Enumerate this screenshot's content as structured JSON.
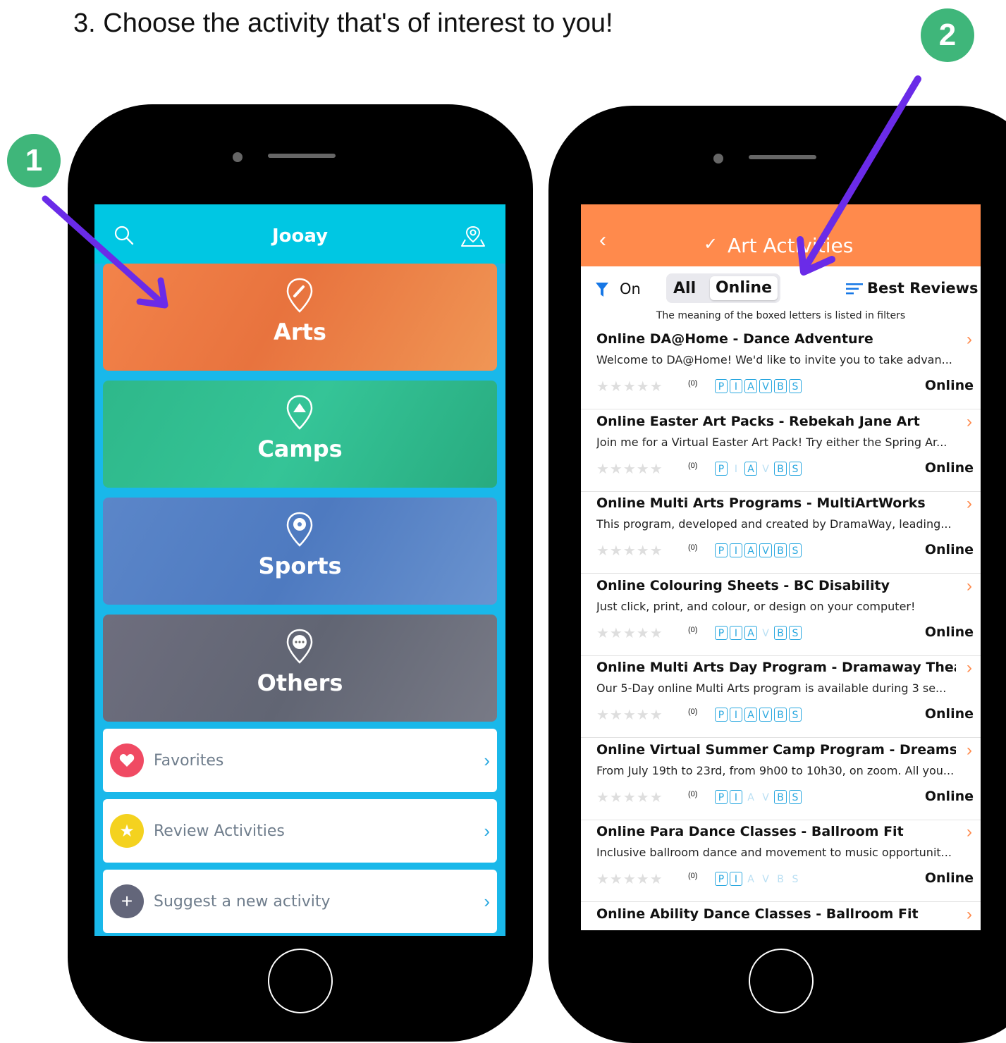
{
  "instruction": "3. Choose the activity that's of interest to you!",
  "badges": {
    "one": "1",
    "two": "2"
  },
  "colors": {
    "badge": "#3fb67a",
    "arrow": "#6a2be8",
    "jooay_header": "#00c7e3",
    "art_header": "#ff8a4c"
  },
  "left_app": {
    "title": "Jooay",
    "icons": {
      "left": "search-icon",
      "right": "map-pin-icon"
    },
    "categories": [
      {
        "label": "Arts",
        "icon": "paintbrush-icon"
      },
      {
        "label": "Camps",
        "icon": "tent-icon"
      },
      {
        "label": "Sports",
        "icon": "soccer-ball-icon"
      },
      {
        "label": "Others",
        "icon": "more-icon"
      }
    ],
    "menu": [
      {
        "label": "Favorites",
        "icon": "heart-icon"
      },
      {
        "label": "Review Activities",
        "icon": "star-icon"
      },
      {
        "label": "Suggest a new activity",
        "icon": "plus-icon"
      }
    ]
  },
  "right_app": {
    "title": "Art Activities",
    "filter_state": "On",
    "segments": {
      "all": "All",
      "online": "Online",
      "selected": "Online"
    },
    "sort": "Best Reviews",
    "note": "The meaning of the boxed letters is listed in filters",
    "activities": [
      {
        "title": "Online DA@Home - Dance Adventure",
        "desc": "Welcome to DA@Home! We'd like to invite you to take advan...",
        "rating": "(0)",
        "mode": "Online",
        "letters": "P,I,A,V,B,S",
        "boxed": "1,1,1,1,1,1"
      },
      {
        "title": "Online Easter Art Packs - Rebekah Jane Art",
        "desc": "Join me for a Virtual Easter Art Pack! Try either the Spring Ar...",
        "rating": "(0)",
        "mode": "Online",
        "letters": "P,I,A,V,B,S",
        "boxed": "1,0,1,0,1,1"
      },
      {
        "title": "Online Multi Arts Programs - MultiArtWorks",
        "desc": "This program, developed and created by DramaWay, leading...",
        "rating": "(0)",
        "mode": "Online",
        "letters": "P,I,A,V,B,S",
        "boxed": "1,1,1,1,1,1"
      },
      {
        "title": "Online Colouring Sheets - BC Disability",
        "desc": "Just click, print, and colour, or design on your computer!",
        "rating": "(0)",
        "mode": "Online",
        "letters": "P,I,A,V,B,S",
        "boxed": "1,1,1,0,1,1"
      },
      {
        "title": "Online Multi Arts Day Program - Dramaway Theatre",
        "desc": "Our 5-Day online Multi Arts program is available during 3 se...",
        "rating": "(0)",
        "mode": "Online",
        "letters": "P,I,A,V,B,S",
        "boxed": "1,1,1,1,1,1"
      },
      {
        "title": "Online Virtual Summer Camp Program - Dreams C...",
        "desc": "From July 19th to 23rd, from 9h00 to 10h30, on zoom. All you...",
        "rating": "(0)",
        "mode": "Online",
        "letters": "P,I,A,V,B,S",
        "boxed": "1,1,0,0,1,1"
      },
      {
        "title": "Online Para Dance Classes - Ballroom Fit",
        "desc": "Inclusive ballroom dance and movement to music opportunit...",
        "rating": "(0)",
        "mode": "Online",
        "letters": "P,I,A,V,B,S",
        "boxed": "1,1,0,0,0,0"
      },
      {
        "title": "Online Ability Dance Classes - Ballroom Fit",
        "desc": "",
        "rating": "",
        "mode": "",
        "letters": "",
        "boxed": ""
      }
    ]
  }
}
